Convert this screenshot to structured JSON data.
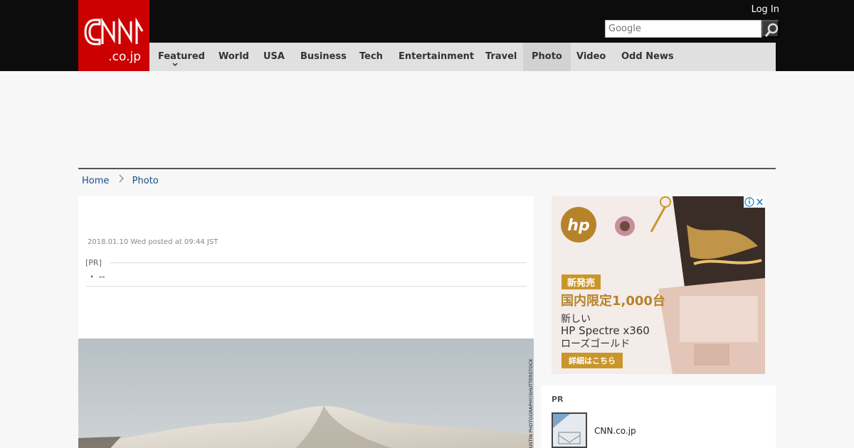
{
  "header": {
    "logo_text": "CNN",
    "logo_sub": ".co.jp",
    "login_label": "Log In",
    "search_placeholder": "Google",
    "nav": [
      {
        "label": "Featured"
      },
      {
        "label": "World"
      },
      {
        "label": "USA"
      },
      {
        "label": "Business"
      },
      {
        "label": "Tech"
      },
      {
        "label": "Entertainment"
      },
      {
        "label": "Travel"
      },
      {
        "label": "Photo",
        "active": true
      },
      {
        "label": "Video"
      },
      {
        "label": "Odd News"
      }
    ]
  },
  "breadcrumb": {
    "home": "Home",
    "current": "Photo"
  },
  "article": {
    "posted": "2018.01.10 Wed posted at 09:44 JST",
    "pr_label": "[PR]",
    "pr_link": "・ --",
    "photo_credit": "JUSTIN PHOTOGRAPHY/SHUTTERSTOCK"
  },
  "ad": {
    "brand": "hp",
    "tag": "新発売",
    "line1": "国内限定1,000台",
    "line2": "新しい",
    "line3": "HP Spectre x360",
    "line4": "ローズゴールド",
    "button": "詳細はこちら"
  },
  "pr_box": {
    "title": "PR",
    "item_name": "CNN.co.jp"
  },
  "colors": {
    "brand_red": "#cc0000",
    "link_blue": "#1a4e8a",
    "nav_bg": "#e0e0e0"
  }
}
